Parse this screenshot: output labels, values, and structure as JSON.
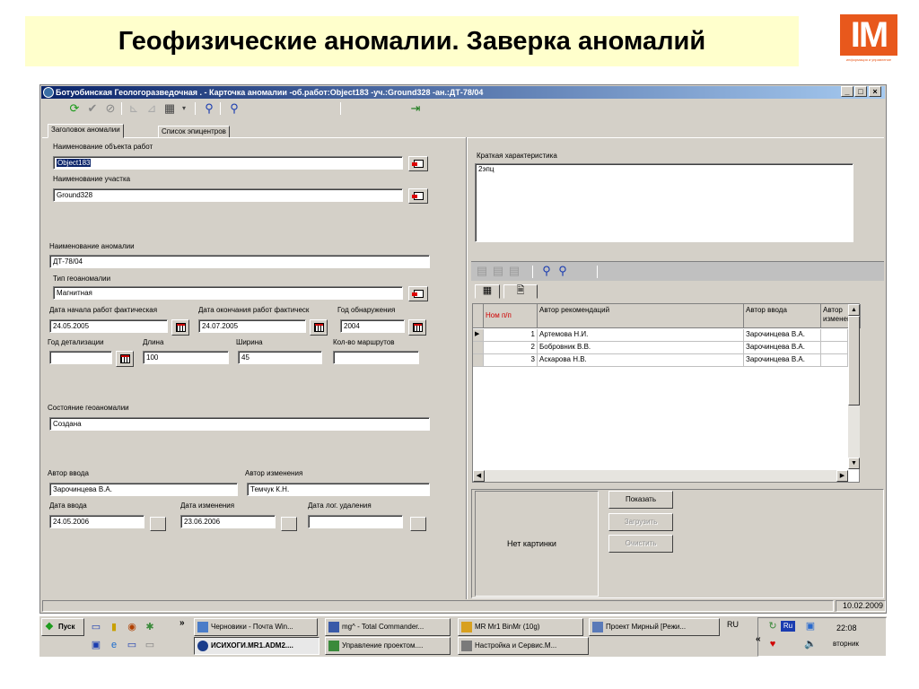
{
  "slide": {
    "title": "Геофизические аномалии. Заверка аномалий",
    "logo_text": "IM",
    "logo_caption": "информация и управление"
  },
  "window": {
    "title": "Ботуобинская Геологоразведочная . - Карточка аномалии -об.работ:Object183 -уч.:Ground328 -ан.:ДТ-78/04",
    "min": "_",
    "max": "□",
    "close": "×"
  },
  "tabs": [
    {
      "label": "Заголовок аномалии"
    },
    {
      "label": "Список эпицентров"
    }
  ],
  "form": {
    "object_label": "Наименование объекта работ",
    "object_value": "Object183",
    "site_label": "Наименование участка",
    "site_value": "Ground328",
    "anomaly_label": "Наименование аномалии",
    "anomaly_value": "ДТ-78/04",
    "type_label": "Тип геоаномалии",
    "type_value": "Магнитная",
    "start_label": "Дата начала работ фактическая",
    "start_value": "24.05.2005",
    "end_label": "Дата окончания работ фактическ",
    "end_value": "24.07.2005",
    "found_label": "Год обнаружения",
    "found_value": "2004",
    "detail_label": "Год детализации",
    "detail_value": "",
    "length_label": "Длина",
    "length_value": "100",
    "width_label": "Ширина",
    "width_value": "45",
    "routes_label": "Кол-во маршрутов",
    "routes_value": "",
    "state_label": "Состояние геоаномалии",
    "state_value": "Создана",
    "author_in_label": "Автор ввода",
    "author_in_value": "Зарочинцева В.А.",
    "author_ch_label": "Автор изменения",
    "author_ch_value": "Темчук К.Н.",
    "date_in_label": "Дата ввода",
    "date_in_value": "24.05.2006",
    "date_ch_label": "Дата изменения",
    "date_ch_value": "23.06.2006",
    "date_del_label": "Дата лог. удаления",
    "date_del_value": ""
  },
  "summary": {
    "label": "Краткая характеристика",
    "value": "2эпц"
  },
  "grid": {
    "headers": [
      "Ном п/п",
      "Автор рекомендаций",
      "Автор ввода",
      "Автор изменен"
    ],
    "rows": [
      {
        "num": "1",
        "author": "Артемова Н.И.",
        "entered_by": "Зарочинцева В.А."
      },
      {
        "num": "2",
        "author": "Бобровник В.В.",
        "entered_by": "Зарочинцева В.А."
      },
      {
        "num": "3",
        "author": "Аскарова Н.В.",
        "entered_by": "Зарочинцева В.А."
      }
    ]
  },
  "picture": {
    "no_picture": "Нет картинки",
    "show": "Показать",
    "load": "Загрузить",
    "clear": "Очистить"
  },
  "status": {
    "date": "10.02.2009"
  },
  "taskbar": {
    "start": "Пуск",
    "chevron": "»",
    "tasks_top": [
      "Черновики - Почта Win...",
      "mg^ - Total Commander...",
      "MR Mr1 BinMr (10g)",
      "Проект Мирный [Режи..."
    ],
    "tasks_bottom": [
      "ИСИХОГИ.MR1.ADM2....",
      "Управление проектом....",
      "Настройка и Сервис.М..."
    ],
    "lang": "RU",
    "tray_lang": "Ru",
    "time": "22:08",
    "day": "вторник"
  }
}
